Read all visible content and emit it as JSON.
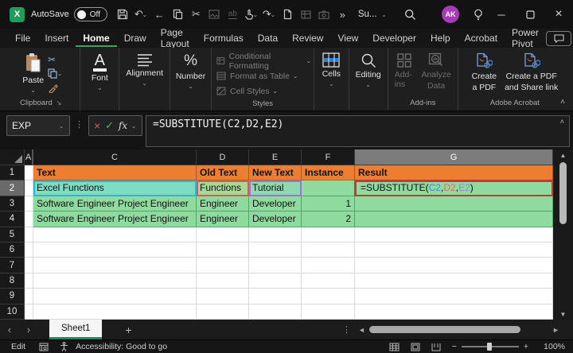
{
  "titlebar": {
    "autosave_label": "AutoSave",
    "autosave_state": "Off",
    "doc_title": "Su...",
    "avatar_initials": "AK"
  },
  "menubar": {
    "items": [
      "File",
      "Insert",
      "Home",
      "Draw",
      "Page Layout",
      "Formulas",
      "Data",
      "Review",
      "View",
      "Developer",
      "Help",
      "Acrobat",
      "Power Pivot"
    ],
    "active_item": "Home"
  },
  "ribbon": {
    "paste_label": "Paste",
    "clipboard_group_label": "Clipboard",
    "font_label": "Font",
    "alignment_label": "Alignment",
    "number_label": "Number",
    "number_glyph": "%",
    "font_glyph": "A",
    "conditional_formatting_label": "Conditional Formatting",
    "format_as_table_label": "Format as Table",
    "cell_styles_label": "Cell Styles",
    "styles_group_label": "Styles",
    "cells_label": "Cells",
    "editing_label": "Editing",
    "addins_label": "Add-ins",
    "analyze_data_line1": "Analyze",
    "analyze_data_line2": "Data",
    "addins_group_label": "Add-ins",
    "create_pdf_line1": "Create",
    "create_pdf_line2": "a PDF",
    "create_pdf_share_line1": "Create a PDF",
    "create_pdf_share_line2": "and Share link",
    "acrobat_group_label": "Adobe Acrobat"
  },
  "formula_bar": {
    "name_box_value": "EXP",
    "fx_label": "fx",
    "formula_text": "=SUBSTITUTE(C2,D2,E2)"
  },
  "grid": {
    "col_letters": [
      "A",
      "C",
      "D",
      "E",
      "F",
      "G"
    ],
    "active_column": "G",
    "row_nums": [
      "1",
      "2",
      "3",
      "4",
      "5",
      "6",
      "7",
      "8",
      "9",
      "10"
    ],
    "r1": {
      "c": "Text",
      "d": "Old Text",
      "e": "New Text",
      "f": "Instance",
      "g": "Result"
    },
    "r2": {
      "c": "Excel Functions",
      "d": "Functions",
      "e": "Tutorial",
      "f": ""
    },
    "r2g": {
      "pre": "=SUBSTITUTE(",
      "ref1": "C2",
      "comma1": ",",
      "ref2": "D2",
      "comma2": ",",
      "ref3": "E2",
      "post": ")"
    },
    "r3": {
      "c": "Software Engineer Project Engineer",
      "d": "Engineer",
      "e": "Developer",
      "f": "1",
      "g": ""
    },
    "r4": {
      "c": "Software Engineer Project Engineer",
      "d": "Engineer",
      "e": "Developer",
      "f": "2",
      "g": ""
    }
  },
  "sheet_tabs": {
    "active_tab": "Sheet1"
  },
  "status_bar": {
    "mode": "Edit",
    "accessibility_text": "Accessibility: Good to go",
    "zoom_level": "100%"
  },
  "icons": {
    "undo": "↶",
    "redo": "↷",
    "back": "←",
    "cut": "✂",
    "overflow": "»",
    "chevron_down": "⌄",
    "chevron_up": "˄",
    "dots_vertical": "⋮",
    "minimize": "─",
    "close": "×",
    "prev_sheet": "‹",
    "next_sheet": "›",
    "add_sheet": "+",
    "scroll_left": "◄",
    "scroll_right": "►",
    "scroll_up": "▲",
    "scroll_down": "▼",
    "dialog_launcher": "↘",
    "cancel": "×",
    "confirm": "✓",
    "minus": "−",
    "plus": "+",
    "replace": "ab"
  },
  "colors": {
    "header_fill": "#ED7D31",
    "data_fill": "#8FDA9F",
    "ref1_border": "#2fb2e0",
    "ref2_border": "#de5950",
    "ref3_border": "#a86ee0",
    "edit_border": "#cf352e",
    "share_button": "#1ea05f",
    "active_tab_underline": "#1e8a5a",
    "avatar": "#a73ab8"
  }
}
